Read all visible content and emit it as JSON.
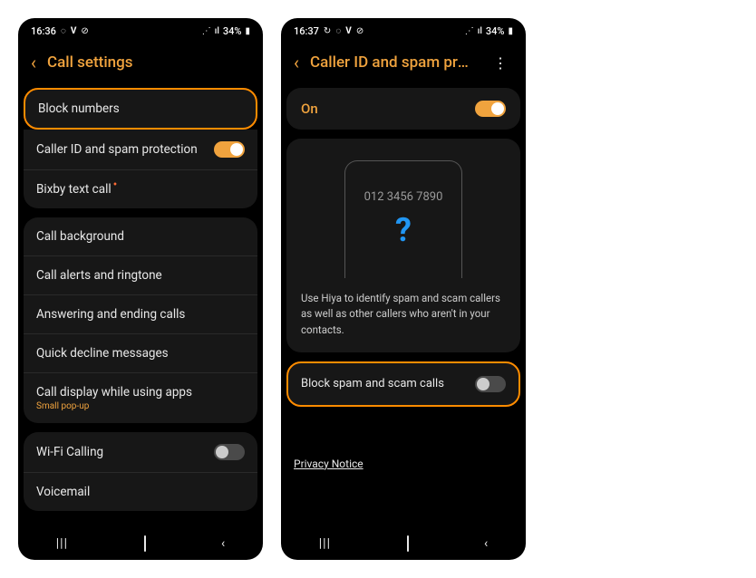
{
  "phone1": {
    "status": {
      "time": "16:36",
      "battery": "34%"
    },
    "header": {
      "title": "Call settings"
    },
    "group1": {
      "block_numbers": "Block numbers",
      "caller_id": "Caller ID and spam protection",
      "bixby": "Bixby text call"
    },
    "group2": {
      "bg": "Call background",
      "alerts": "Call alerts and ringtone",
      "answer": "Answering and ending calls",
      "decline": "Quick decline messages",
      "display": "Call display while using apps",
      "display_sub": "Small pop-up"
    },
    "group3": {
      "wifi": "Wi-Fi Calling",
      "vm": "Voicemail"
    }
  },
  "phone2": {
    "status": {
      "time": "16:37",
      "battery": "34%"
    },
    "header": {
      "title": "Caller ID and spam pro…"
    },
    "on_label": "On",
    "mock": {
      "number": "012 3456 7890",
      "q": "?"
    },
    "desc": "Use Hiya to identify spam and scam callers as well as other callers who aren't in your contacts.",
    "block_label": "Block spam and scam calls",
    "privacy": "Privacy Notice"
  }
}
